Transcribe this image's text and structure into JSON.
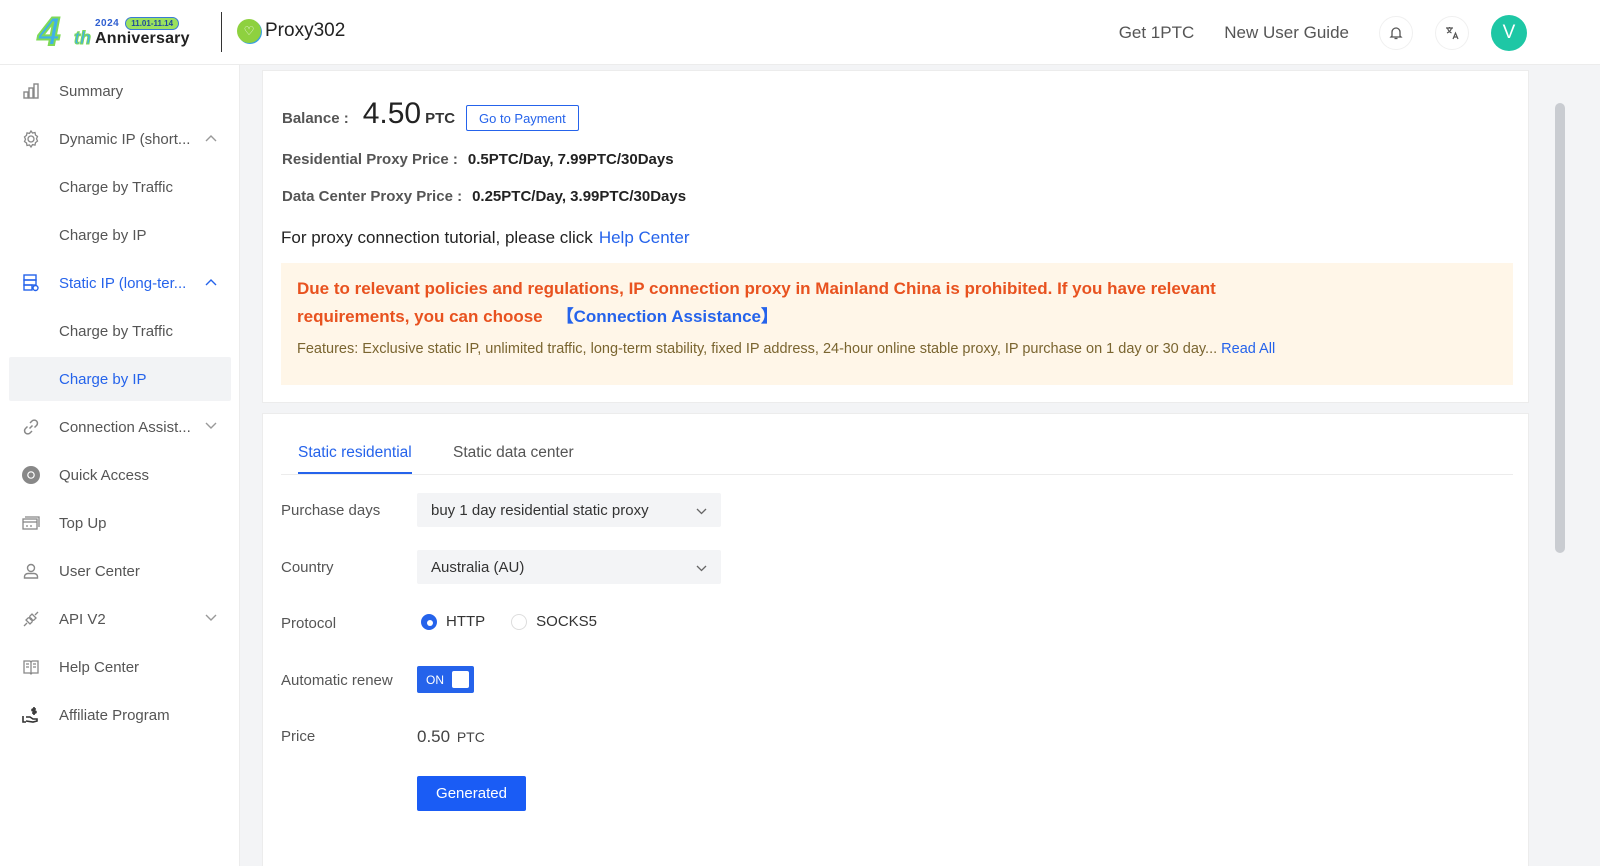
{
  "header": {
    "anniversary": {
      "year": "2024",
      "dates": "11.01-11.14",
      "number": "4",
      "suffix": "th",
      "label": "Anniversary"
    },
    "brand": {
      "mark": "♡",
      "name": "Proxy302"
    },
    "links": [
      "Get 1PTC",
      "New User Guide"
    ],
    "icons": {
      "notification": "bell-icon",
      "language": "translate-icon"
    },
    "avatar_initial": "V",
    "colors": {
      "avatar": "#1ec7a5",
      "accent": "#2563eb"
    }
  },
  "sidebar": {
    "items": [
      {
        "label": "Summary",
        "icon": "bar-chart-icon"
      },
      {
        "label": "Dynamic IP (short...",
        "icon": "gear-icon",
        "chevron": "up"
      },
      {
        "label": "Charge by Traffic"
      },
      {
        "label": "Charge by IP"
      },
      {
        "label": "Static IP (long-ter...",
        "icon": "server-icon",
        "chevron": "up"
      },
      {
        "label": "Charge by Traffic"
      },
      {
        "label": "Charge by IP",
        "selected": true
      },
      {
        "label": "Connection Assist...",
        "icon": "link-icon",
        "chevron": "down"
      },
      {
        "label": "Quick Access",
        "icon": "chrome-icon"
      },
      {
        "label": "Top Up",
        "icon": "card-icon"
      },
      {
        "label": "User Center",
        "icon": "user-icon"
      },
      {
        "label": "API V2",
        "icon": "plug-icon",
        "chevron": "down"
      },
      {
        "label": "Help Center",
        "icon": "book-icon"
      },
      {
        "label": "Affiliate Program",
        "icon": "hand-dollar-icon"
      }
    ]
  },
  "account": {
    "balance_label": "Balance :",
    "balance_value": "4.50",
    "balance_unit": "PTC",
    "pay_button": "Go to Payment",
    "residential_label": "Residential Proxy Price :",
    "residential_value": "0.5PTC/Day, 7.99PTC/30Days",
    "datacenter_label": "Data Center Proxy Price :",
    "datacenter_value": "0.25PTC/Day, 3.99PTC/30Days",
    "tutorial_text": "For proxy connection tutorial, please click",
    "tutorial_link": "Help Center"
  },
  "notice": {
    "warning": "Due to relevant policies and regulations, IP connection proxy in Mainland China is prohibited. If you have relevant requirements, you can choose",
    "assist_link": "【Connection Assistance】",
    "features": "Features: Exclusive static IP, unlimited traffic, long-term stability, fixed IP address, 24-hour online stable proxy, IP purchase on 1 day or 30 day...",
    "read_all": "Read All"
  },
  "purchase": {
    "tabs": [
      {
        "label": "Static residential",
        "active": true
      },
      {
        "label": "Static data center",
        "active": false
      }
    ],
    "purchase_days_label": "Purchase days",
    "purchase_days_value": "buy 1 day residential static proxy",
    "country_label": "Country",
    "country_value": "Australia (AU)",
    "protocol_label": "Protocol",
    "protocol_options": [
      {
        "label": "HTTP",
        "checked": true
      },
      {
        "label": "SOCKS5",
        "checked": false
      }
    ],
    "auto_renew_label": "Automatic renew",
    "auto_renew_state": "ON",
    "price_label": "Price",
    "price_value": "0.50",
    "price_unit": "PTC",
    "generate_button": "Generated"
  }
}
